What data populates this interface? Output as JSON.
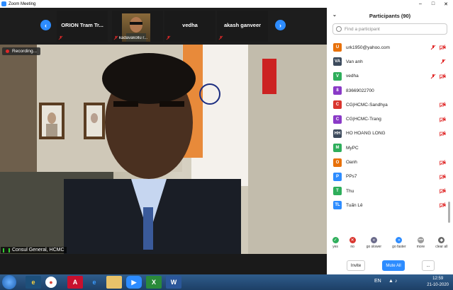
{
  "window": {
    "title": "Zoom Meeting",
    "controls": [
      "–",
      "□",
      "✕"
    ]
  },
  "thumbnails": [
    {
      "name": "ORION Tram Tr...",
      "muted": true
    },
    {
      "name": "",
      "sub": "kadavakollu r...",
      "muted": true,
      "has_video": true
    },
    {
      "name": "vedha",
      "muted": true
    },
    {
      "name": "akash ganveer",
      "muted": true
    }
  ],
  "video": {
    "recording_label": "Recording...",
    "speaker_name": "Consul General, HCMC"
  },
  "participants": {
    "title": "Participants (90)",
    "search_placeholder": "Find a participant",
    "items": [
      {
        "initials": "U",
        "name": "urk1950@yahoo.com",
        "color": "#e8710a",
        "mic_muted": true,
        "cam_off": true
      },
      {
        "initials": "VA",
        "name": "Van anh",
        "color": "#3c4a5c",
        "mic_muted": true,
        "cam_off": false
      },
      {
        "initials": "V",
        "name": "vedha",
        "color": "#2eae5b",
        "mic_muted": true,
        "cam_off": true
      },
      {
        "initials": "8",
        "name": "83669022700",
        "color": "#8a3ac7",
        "mic_muted": false,
        "cam_off": false
      },
      {
        "initials": "C",
        "name": "CG|HCMC-Sandhya",
        "color": "#d9352e",
        "mic_muted": false,
        "cam_off": true
      },
      {
        "initials": "C",
        "name": "CG|HCMC-Trang",
        "color": "#8a3ac7",
        "mic_muted": false,
        "cam_off": true
      },
      {
        "initials": "HH",
        "name": "HO HOANG LONG",
        "color": "#3c4a5c",
        "mic_muted": false,
        "cam_off": true
      },
      {
        "initials": "M",
        "name": "MyPC",
        "color": "#2eae5b",
        "mic_muted": false,
        "cam_off": false
      },
      {
        "initials": "O",
        "name": "Oanh",
        "color": "#e8710a",
        "mic_muted": false,
        "cam_off": true
      },
      {
        "initials": "P",
        "name": "PPs7",
        "color": "#2d8cff",
        "mic_muted": false,
        "cam_off": true
      },
      {
        "initials": "T",
        "name": "Thu",
        "color": "#2eae5b",
        "mic_muted": false,
        "cam_off": true
      },
      {
        "initials": "TL",
        "name": "Tuấn Lê",
        "color": "#2d8cff",
        "mic_muted": false,
        "cam_off": true
      }
    ],
    "reactions": [
      {
        "label": "yes",
        "symbol": "✓",
        "color": "#2eae5b"
      },
      {
        "label": "no",
        "symbol": "✕",
        "color": "#d9352e"
      },
      {
        "label": "go slower",
        "symbol": "«",
        "color": "#6a6a8a"
      },
      {
        "label": "go faster",
        "symbol": "»",
        "color": "#2d8cff"
      },
      {
        "label": "more",
        "symbol": "•••",
        "color": "#9a9a9a"
      },
      {
        "label": "clear all",
        "symbol": "◆",
        "color": "#666"
      }
    ],
    "buttons": {
      "invite": "Invite",
      "mute_all": "Mute All",
      "more": "..."
    }
  },
  "taskbar": {
    "time": "12:59",
    "date": "21-10-2020",
    "tray_lang": "EN"
  }
}
